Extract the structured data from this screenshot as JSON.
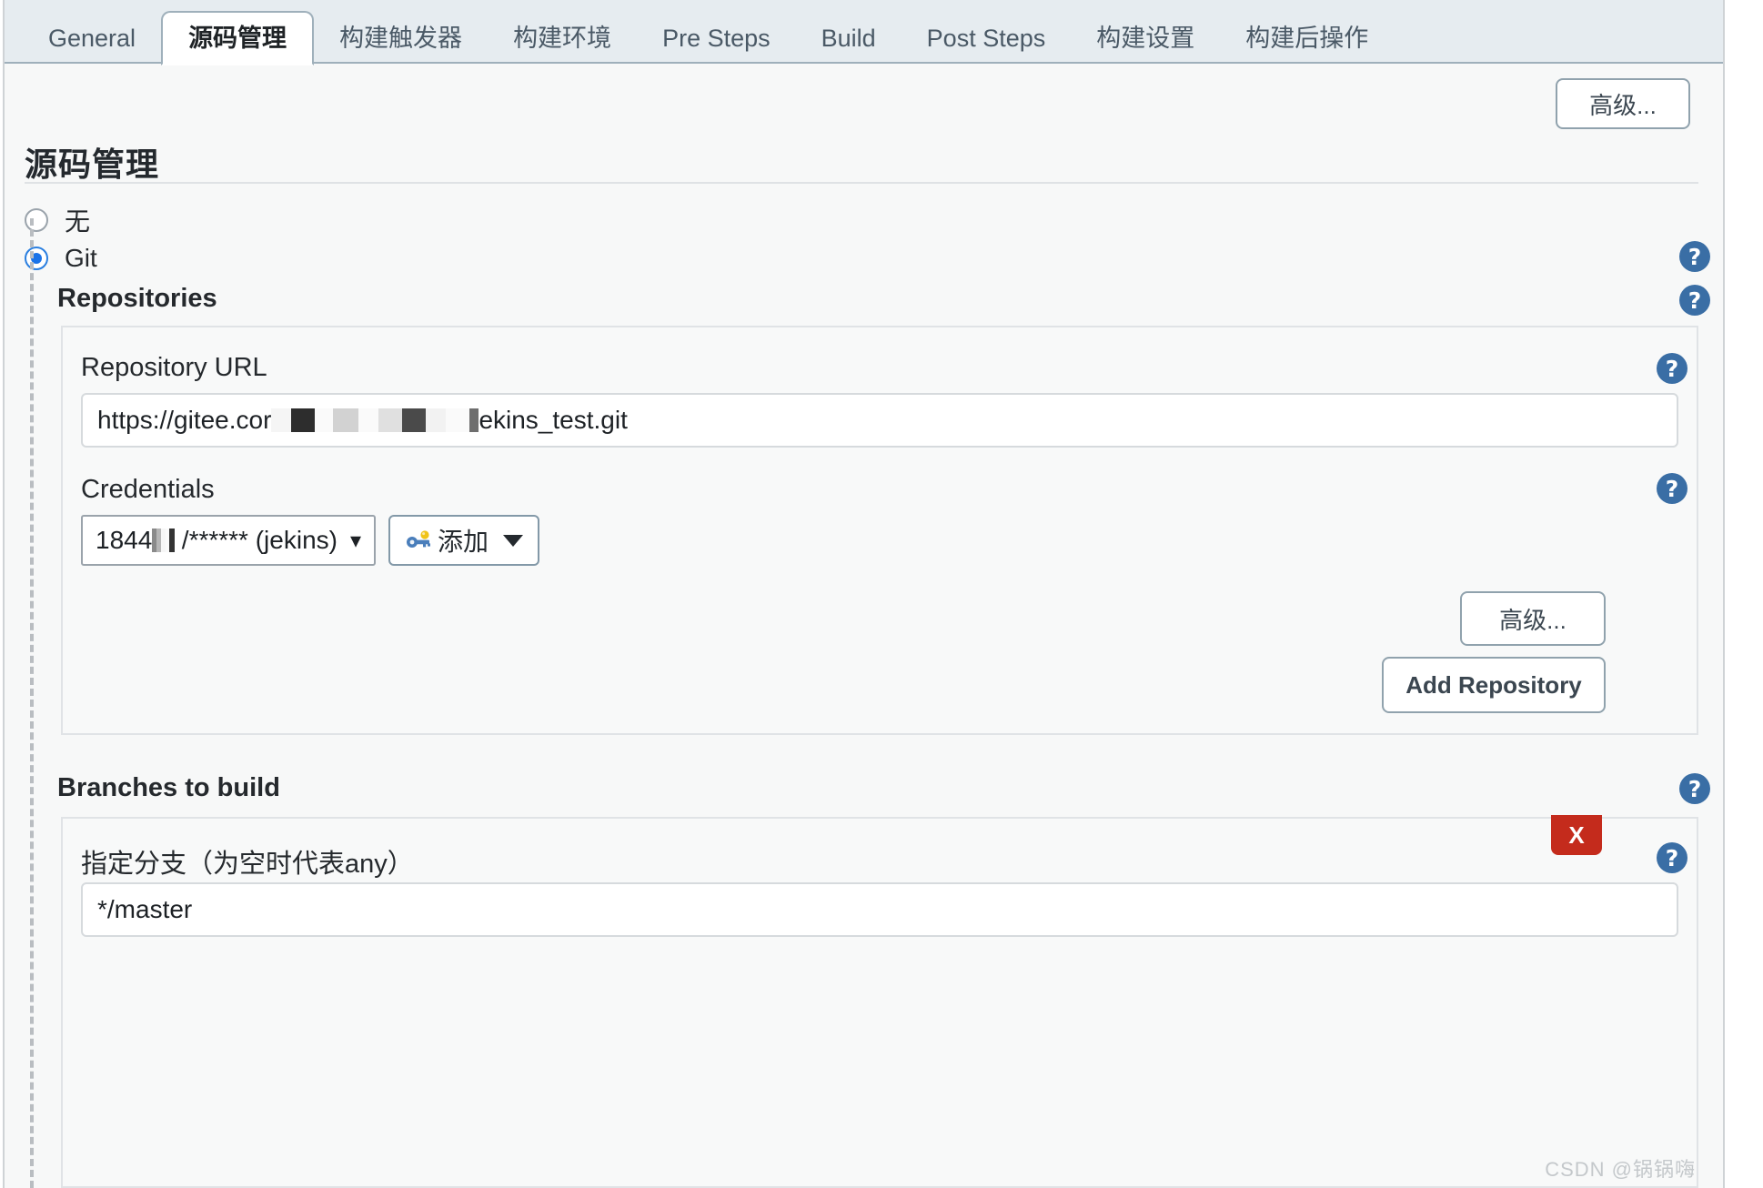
{
  "tabs": [
    {
      "label": "General",
      "active": false
    },
    {
      "label": "源码管理",
      "active": true
    },
    {
      "label": "构建触发器",
      "active": false
    },
    {
      "label": "构建环境",
      "active": false
    },
    {
      "label": "Pre Steps",
      "active": false
    },
    {
      "label": "Build",
      "active": false
    },
    {
      "label": "Post Steps",
      "active": false
    },
    {
      "label": "构建设置",
      "active": false
    },
    {
      "label": "构建后操作",
      "active": false
    }
  ],
  "toolbar": {
    "advanced_top_label": "高级..."
  },
  "section": {
    "title": "源码管理"
  },
  "scm_options": [
    {
      "label": "无",
      "checked": false
    },
    {
      "label": "Git",
      "checked": true
    }
  ],
  "repositories": {
    "label": "Repositories",
    "repository_url": {
      "label": "Repository URL",
      "value_prefix": "https://gitee.cor",
      "value_suffix": "ekins_test.git"
    },
    "credentials": {
      "label": "Credentials",
      "selected": "1844",
      "selected_tail": "/****** (jekins)",
      "add_label": "添加",
      "add_icon": "key-icon",
      "chevron_icon": "chevron-down-icon"
    },
    "advanced_label": "高级...",
    "add_repository_label": "Add Repository"
  },
  "branches": {
    "label": "Branches to build",
    "specifier_label": "指定分支（为空时代表any）",
    "specifier_value": "*/master",
    "delete_label": "X"
  },
  "help_icon_glyph": "?",
  "watermark": "CSDN @锅锅嗨",
  "colors": {
    "accent_blue": "#1a73e8",
    "help_blue": "#3a6ea5",
    "danger_red": "#c42b1c",
    "tabbar_bg": "#e6ecf0",
    "content_bg": "#f7f8f8"
  }
}
